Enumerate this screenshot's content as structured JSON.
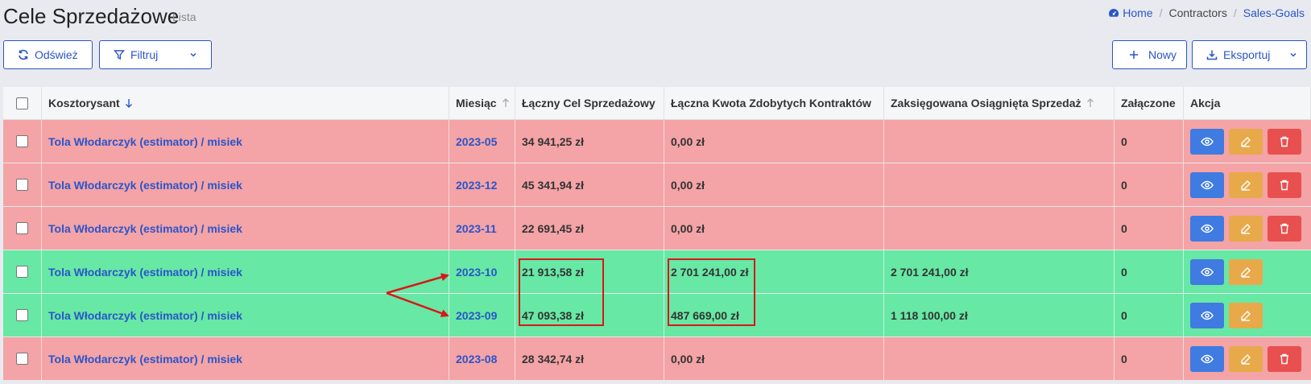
{
  "header": {
    "title": "Cele Sprzedażowe",
    "subtitle": "Lista",
    "breadcrumb": {
      "home": "Home",
      "section": "Contractors",
      "current": "Sales-Goals"
    }
  },
  "toolbar": {
    "refresh_label": "Odśwież",
    "filter_label": "Filtruj",
    "new_label": "Nowy",
    "export_label": "Eksportuj"
  },
  "table": {
    "columns": {
      "estimator": "Kosztorysant",
      "month": "Miesiąc",
      "total_goal": "Łączny Cel Sprzedażowy",
      "won_contracts": "Łączna Kwota Zdobytych Kontraktów",
      "booked_sales": "Zaksięgowana Osiągnięta Sprzedaż",
      "attached": "Załączone",
      "actions": "Akcja"
    },
    "rows": [
      {
        "estimator": "Tola Włodarczyk (estimator) / misiek",
        "month": "2023-05",
        "total_goal": "34 941,25 zł",
        "won_contracts": "0,00 zł",
        "booked_sales": "",
        "attached": "0",
        "status": "red",
        "deletable": true
      },
      {
        "estimator": "Tola Włodarczyk (estimator) / misiek",
        "month": "2023-12",
        "total_goal": "45 341,94 zł",
        "won_contracts": "0,00 zł",
        "booked_sales": "",
        "attached": "0",
        "status": "red",
        "deletable": true
      },
      {
        "estimator": "Tola Włodarczyk (estimator) / misiek",
        "month": "2023-11",
        "total_goal": "22 691,45 zł",
        "won_contracts": "0,00 zł",
        "booked_sales": "",
        "attached": "0",
        "status": "red",
        "deletable": true
      },
      {
        "estimator": "Tola Włodarczyk (estimator) / misiek",
        "month": "2023-10",
        "total_goal": "21 913,58 zł",
        "won_contracts": "2 701 241,00 zł",
        "booked_sales": "2 701 241,00 zł",
        "attached": "0",
        "status": "green",
        "deletable": false
      },
      {
        "estimator": "Tola Włodarczyk (estimator) / misiek",
        "month": "2023-09",
        "total_goal": "47 093,38 zł",
        "won_contracts": "487 669,00 zł",
        "booked_sales": "1 118 100,00 zł",
        "attached": "0",
        "status": "green",
        "deletable": false
      },
      {
        "estimator": "Tola Włodarczyk (estimator) / misiek",
        "month": "2023-08",
        "total_goal": "28 342,74 zł",
        "won_contracts": "0,00 zł",
        "booked_sales": "",
        "attached": "0",
        "status": "red",
        "deletable": true
      }
    ]
  },
  "colors": {
    "accent": "#2a55c9",
    "row_red": "#f4a3a6",
    "row_green": "#67e8a5",
    "view_button": "#3f7be0",
    "edit_button": "#e8a94a",
    "delete_button": "#e85050",
    "annotation": "#d81818"
  },
  "icons": {
    "refresh": "refresh-icon",
    "filter": "filter-icon",
    "new": "plus-icon",
    "export": "download-icon",
    "home": "dashboard-icon",
    "view": "eye-icon",
    "edit": "pencil-icon",
    "delete": "trash-icon"
  }
}
